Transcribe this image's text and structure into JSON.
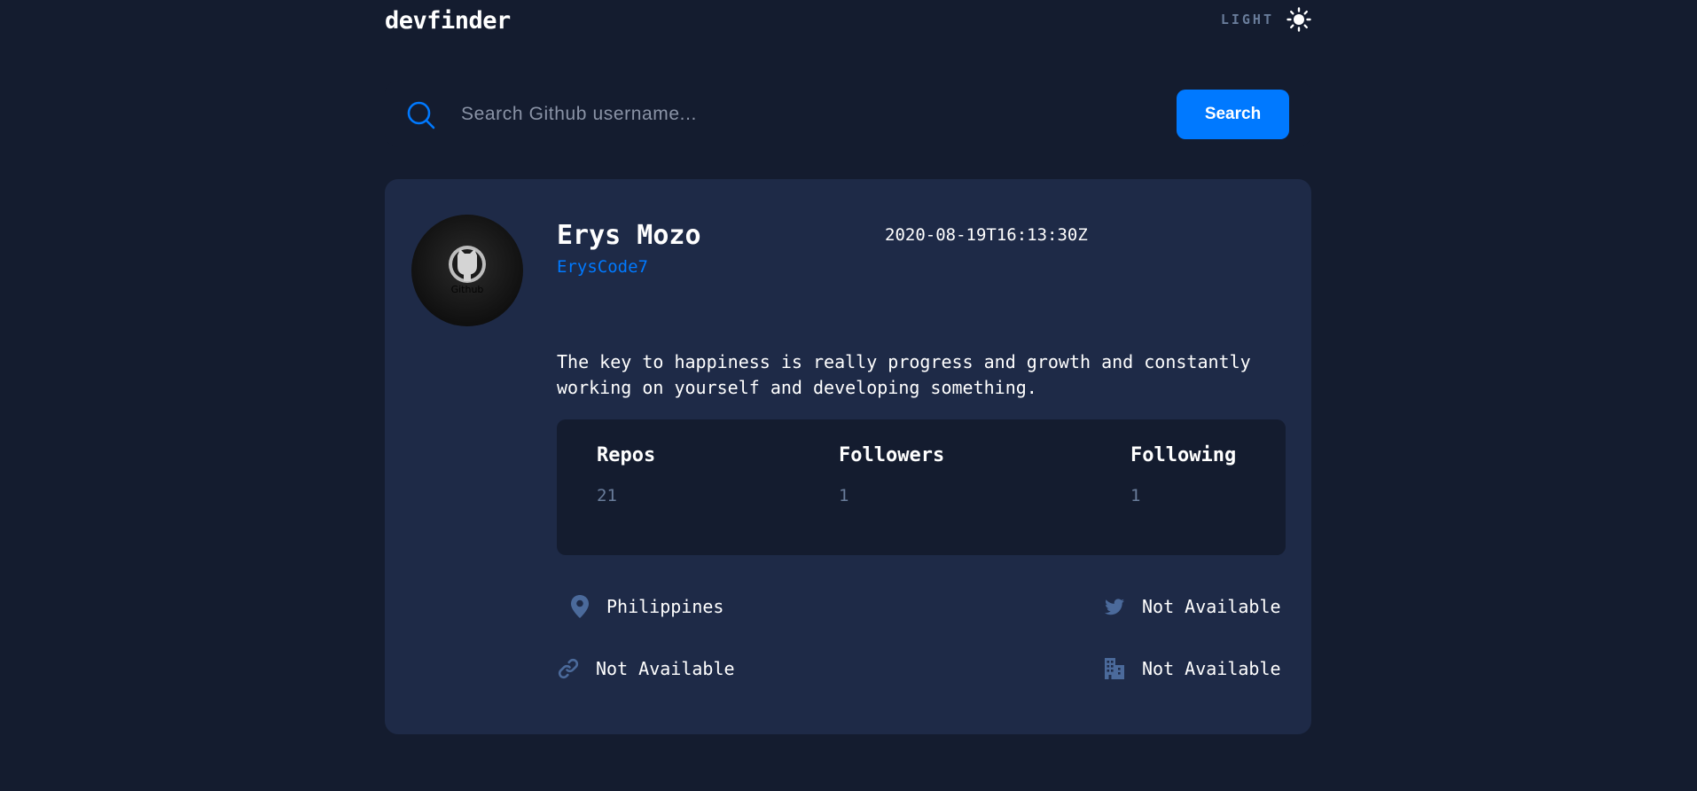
{
  "header": {
    "logo": "devfinder",
    "theme_label": "LIGHT",
    "theme_icon": "sun-icon"
  },
  "search": {
    "placeholder": "Search Github username...",
    "value": "",
    "button_label": "Search",
    "icon": "search-icon"
  },
  "profile": {
    "name": "Erys Mozo",
    "login": "ErysCode7",
    "joined": "2020-08-19T16:13:30Z",
    "bio": "The key to happiness is really progress and growth and constantly working on yourself and developing something.",
    "avatar_caption": "Github"
  },
  "stats": [
    {
      "label": "Repos",
      "value": "21"
    },
    {
      "label": "Followers",
      "value": "1"
    },
    {
      "label": "Following",
      "value": "1"
    }
  ],
  "links": {
    "location": "Philippines",
    "twitter": "Not Available",
    "website": "Not Available",
    "company": "Not Available"
  },
  "colors": {
    "background": "#141c2f",
    "card": "#1e2a47",
    "accent": "#0079ff",
    "muted": "#697c9a"
  }
}
